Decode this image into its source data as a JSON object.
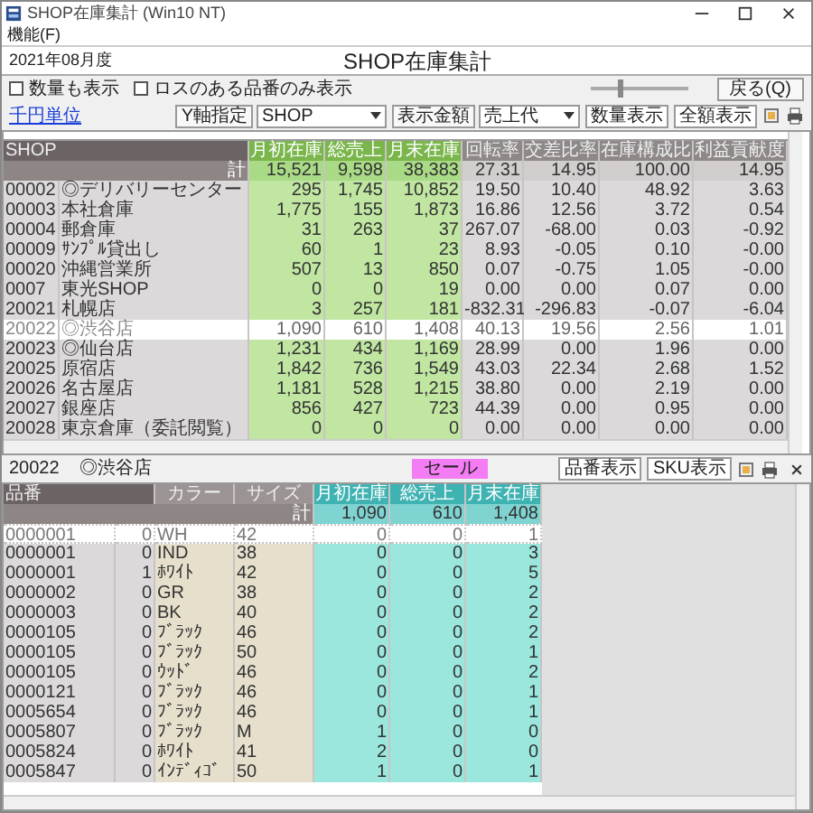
{
  "window": {
    "title": "SHOP在庫集計 (Win10 NT)"
  },
  "menu": [
    "機能(F)"
  ],
  "period": "2021年08月度",
  "heading": "SHOP在庫集計",
  "options": [
    {
      "label": "数量も表示",
      "checked": false
    },
    {
      "label": "ロスのある品番のみ表示",
      "checked": false
    }
  ],
  "zoom_slider": {
    "level": 0.3
  },
  "back_button": "戻る(Q)",
  "unit_link": "千円単位",
  "axis_select": {
    "label": "Y軸指定",
    "value": "SHOP"
  },
  "amount_select": {
    "label": "表示金額",
    "value": "売上代"
  },
  "view_buttons": [
    "数量表示",
    "全額表示"
  ],
  "shop_table": {
    "key_label": "SHOP",
    "columns": [
      {
        "label": "月初在庫",
        "kind": "stock"
      },
      {
        "label": "総売上",
        "kind": "stock"
      },
      {
        "label": "月末在庫",
        "kind": "stock"
      },
      {
        "label": "回転率",
        "kind": "ratio"
      },
      {
        "label": "交差比率",
        "kind": "ratio"
      },
      {
        "label": "在庫構成比",
        "kind": "ratio"
      },
      {
        "label": "利益貢献度",
        "kind": "ratio"
      }
    ],
    "total": {
      "label": "計",
      "values": [
        "15,521",
        "9,598",
        "38,383",
        "27.31",
        "14.95",
        "100.00",
        "14.95"
      ]
    },
    "rows": [
      {
        "code": "00002",
        "name": "◎デリバリーセンター",
        "values": [
          "295",
          "1,745",
          "10,852",
          "19.50",
          "10.40",
          "48.92",
          "3.63"
        ],
        "selected": false
      },
      {
        "code": "00003",
        "name": "本社倉庫",
        "values": [
          "1,775",
          "155",
          "1,873",
          "16.86",
          "12.56",
          "3.72",
          "0.54"
        ],
        "selected": false
      },
      {
        "code": "00004",
        "name": "郵倉庫",
        "values": [
          "31",
          "263",
          "37",
          "267.07",
          "-68.00",
          "0.03",
          "-0.92"
        ],
        "selected": false
      },
      {
        "code": "00009",
        "name": "ｻﾝﾌﾟﾙ貸出し",
        "values": [
          "60",
          "1",
          "23",
          "8.93",
          "-0.05",
          "0.10",
          "-0.00"
        ],
        "selected": false
      },
      {
        "code": "00020",
        "name": "沖縄営業所",
        "values": [
          "507",
          "13",
          "850",
          "0.07",
          "-0.75",
          "1.05",
          "-0.00"
        ],
        "selected": false
      },
      {
        "code": "0007",
        "name": "東光SHOP",
        "values": [
          "0",
          "0",
          "19",
          "0.00",
          "0.00",
          "0.07",
          "0.00"
        ],
        "selected": false
      },
      {
        "code": "20021",
        "name": "札幌店",
        "values": [
          "3",
          "257",
          "181",
          "-832.31",
          "-296.83",
          "-0.07",
          "-6.04"
        ],
        "selected": false
      },
      {
        "code": "20022",
        "name": "◎渋谷店",
        "values": [
          "1,090",
          "610",
          "1,408",
          "40.13",
          "19.56",
          "2.56",
          "1.01"
        ],
        "selected": true
      },
      {
        "code": "20023",
        "name": "◎仙台店",
        "values": [
          "1,231",
          "434",
          "1,169",
          "28.99",
          "0.00",
          "1.96",
          "0.00"
        ],
        "selected": false
      },
      {
        "code": "20025",
        "name": "原宿店",
        "values": [
          "1,842",
          "736",
          "1,549",
          "43.03",
          "22.34",
          "2.68",
          "1.52"
        ],
        "selected": false
      },
      {
        "code": "20026",
        "name": "名古屋店",
        "values": [
          "1,181",
          "528",
          "1,215",
          "38.80",
          "0.00",
          "2.19",
          "0.00"
        ],
        "selected": false
      },
      {
        "code": "20027",
        "name": "銀座店",
        "values": [
          "856",
          "427",
          "723",
          "44.39",
          "0.00",
          "0.95",
          "0.00"
        ],
        "selected": false
      },
      {
        "code": "20028",
        "name": "東京倉庫（委託閲覧）",
        "values": [
          "0",
          "0",
          "0",
          "0.00",
          "0.00",
          "0.00",
          "0.00"
        ],
        "selected": false
      }
    ]
  },
  "detail": {
    "code": "20022",
    "name": "◎渋谷店",
    "badge": "セール",
    "buttons": [
      "品番表示",
      "SKU表示"
    ],
    "columns": [
      {
        "label": "品番",
        "kind": "key"
      },
      {
        "label": "カラー",
        "kind": "attr"
      },
      {
        "label": "サイズ",
        "kind": "attr"
      },
      {
        "label": "月初在庫",
        "kind": "stock"
      },
      {
        "label": "総売上",
        "kind": "stock"
      },
      {
        "label": "月末在庫",
        "kind": "stock"
      }
    ],
    "total": {
      "label": "計",
      "values": [
        "1,090",
        "610",
        "1,408"
      ]
    },
    "rows": [
      {
        "code": "0000001",
        "loss": "0",
        "color_name": "WH",
        "size": "42",
        "values": [
          "0",
          "0",
          "1"
        ],
        "selected": true
      },
      {
        "code": "0000001",
        "loss": "0",
        "color_name": "IND",
        "size": "38",
        "values": [
          "0",
          "0",
          "3"
        ],
        "selected": false
      },
      {
        "code": "0000001",
        "loss": "1",
        "color_name": "ﾎﾜｲﾄ",
        "size": "42",
        "values": [
          "0",
          "0",
          "5"
        ],
        "selected": false
      },
      {
        "code": "0000002",
        "loss": "0",
        "color_name": "GR",
        "size": "38",
        "values": [
          "0",
          "0",
          "2"
        ],
        "selected": false
      },
      {
        "code": "0000003",
        "loss": "0",
        "color_name": "BK",
        "size": "40",
        "values": [
          "0",
          "0",
          "2"
        ],
        "selected": false
      },
      {
        "code": "0000105",
        "loss": "0",
        "color_name": "ﾌﾞﾗｯｸ",
        "size": "46",
        "values": [
          "0",
          "0",
          "2"
        ],
        "selected": false
      },
      {
        "code": "0000105",
        "loss": "0",
        "color_name": "ﾌﾞﾗｯｸ",
        "size": "50",
        "values": [
          "0",
          "0",
          "1"
        ],
        "selected": false
      },
      {
        "code": "0000105",
        "loss": "0",
        "color_name": "ｳｯﾄﾞ",
        "size": "46",
        "values": [
          "0",
          "0",
          "2"
        ],
        "selected": false
      },
      {
        "code": "0000121",
        "loss": "0",
        "color_name": "ﾌﾞﾗｯｸ",
        "size": "46",
        "values": [
          "0",
          "0",
          "1"
        ],
        "selected": false
      },
      {
        "code": "0005654",
        "loss": "0",
        "color_name": "ﾌﾞﾗｯｸ",
        "size": "46",
        "values": [
          "0",
          "0",
          "1"
        ],
        "selected": false
      },
      {
        "code": "0005807",
        "loss": "0",
        "color_name": "ﾌﾞﾗｯｸ",
        "size": "M",
        "values": [
          "1",
          "0",
          "0"
        ],
        "selected": false
      },
      {
        "code": "0005824",
        "loss": "0",
        "color_name": "ﾎﾜｲﾄ",
        "size": "41",
        "values": [
          "2",
          "0",
          "0"
        ],
        "selected": false
      },
      {
        "code": "0005847",
        "loss": "0",
        "color_name": "ｲﾝﾃﾞｨｺﾞ",
        "size": "50",
        "values": [
          "1",
          "0",
          "1"
        ],
        "selected": false
      }
    ]
  }
}
